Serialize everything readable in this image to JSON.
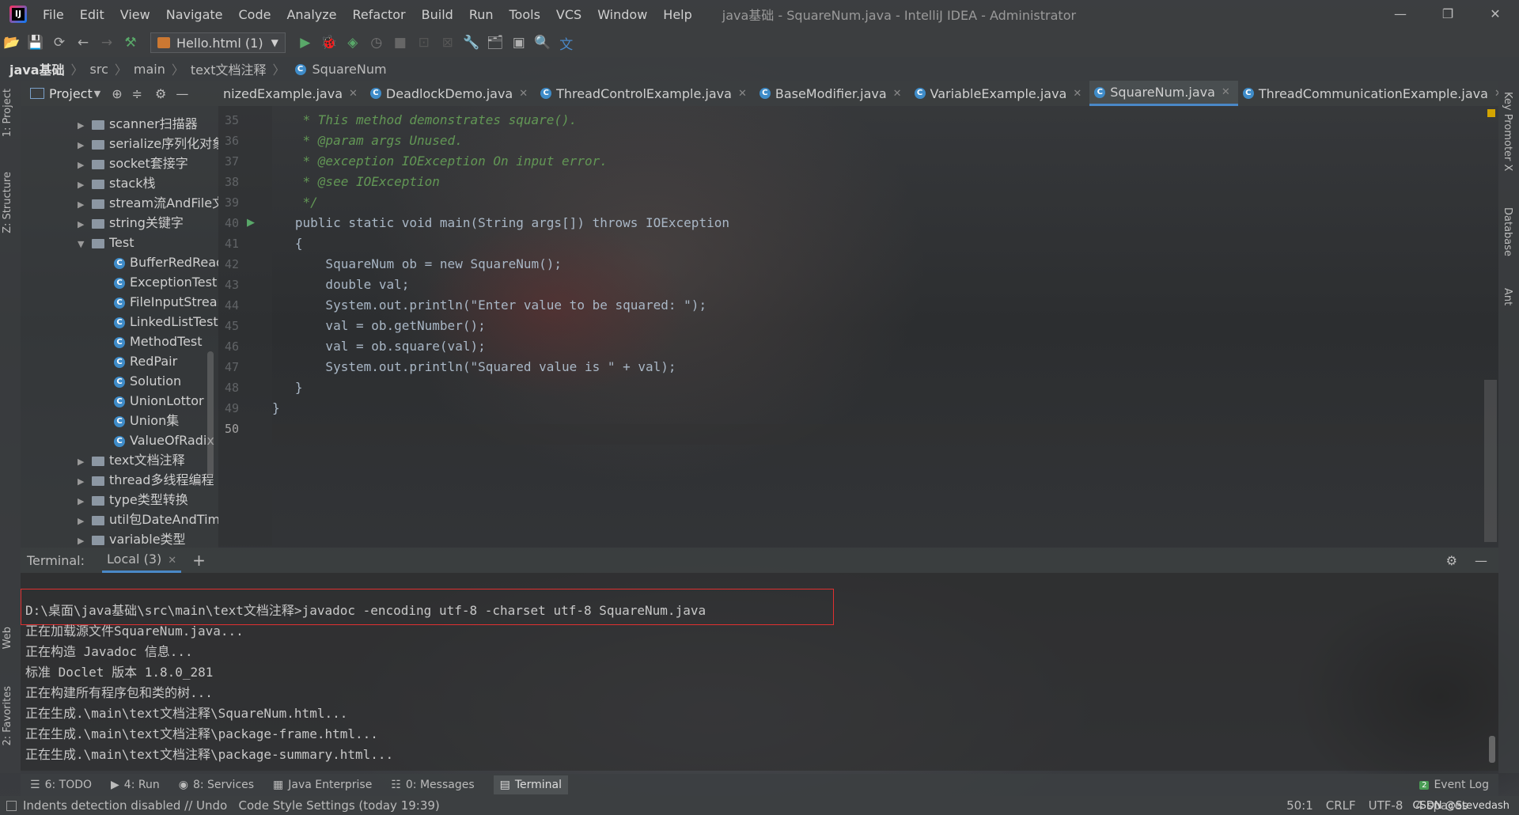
{
  "menubar": {
    "items": [
      "File",
      "Edit",
      "View",
      "Navigate",
      "Code",
      "Analyze",
      "Refactor",
      "Build",
      "Run",
      "Tools",
      "VCS",
      "Window",
      "Help"
    ],
    "title": "java基础 - SquareNum.java - IntelliJ IDEA - Administrator"
  },
  "toolbar": {
    "run_config": "Hello.html (1)"
  },
  "breadcrumb": [
    "java基础",
    "src",
    "main",
    "text文档注释",
    "SquareNum"
  ],
  "left_strip": {
    "project": "1: Project",
    "structure": "Z: Structure",
    "web": "Web",
    "favorites": "2: Favorites"
  },
  "right_strip": {
    "key_promoter": "Key Promoter X",
    "database": "Database",
    "ant": "Ant"
  },
  "project_panel": {
    "label": "Project",
    "items": [
      {
        "label": "scanner扫描器",
        "type": "folder",
        "expanded": false
      },
      {
        "label": "serialize序列化对象",
        "type": "folder",
        "expanded": false
      },
      {
        "label": "socket套接字",
        "type": "folder",
        "expanded": false
      },
      {
        "label": "stack栈",
        "type": "folder",
        "expanded": false
      },
      {
        "label": "stream流AndFile文",
        "type": "folder",
        "expanded": false
      },
      {
        "label": "string关键字",
        "type": "folder",
        "expanded": false
      },
      {
        "label": "Test",
        "type": "folder",
        "expanded": true
      },
      {
        "label": "BufferRedRead",
        "type": "class"
      },
      {
        "label": "ExceptionTest",
        "type": "class"
      },
      {
        "label": "FileInputStrean",
        "type": "class"
      },
      {
        "label": "LinkedListTest",
        "type": "class"
      },
      {
        "label": "MethodTest",
        "type": "class"
      },
      {
        "label": "RedPair",
        "type": "class"
      },
      {
        "label": "Solution",
        "type": "class"
      },
      {
        "label": "UnionLottor",
        "type": "class"
      },
      {
        "label": "Union集",
        "type": "class"
      },
      {
        "label": "ValueOfRadix",
        "type": "class"
      },
      {
        "label": "text文档注释",
        "type": "folder",
        "expanded": false
      },
      {
        "label": "thread多线程编程",
        "type": "folder",
        "expanded": false
      },
      {
        "label": "type类型转换",
        "type": "folder",
        "expanded": false
      },
      {
        "label": "util包DateAndTim",
        "type": "folder",
        "expanded": false
      },
      {
        "label": "variable类型",
        "type": "folder",
        "expanded": false
      }
    ]
  },
  "tabs": [
    {
      "label": "nizedExample.java",
      "active": false
    },
    {
      "label": "DeadlockDemo.java",
      "active": false
    },
    {
      "label": "ThreadControlExample.java",
      "active": false
    },
    {
      "label": "BaseModifier.java",
      "active": false
    },
    {
      "label": "VariableExample.java",
      "active": false
    },
    {
      "label": "SquareNum.java",
      "active": true
    },
    {
      "label": "ThreadCommunicationExample.java",
      "active": false
    },
    {
      "label": "T",
      "active": false
    }
  ],
  "editor": {
    "line_numbers": [
      "35",
      "36",
      "37",
      "38",
      "39",
      "40",
      "41",
      "42",
      "43",
      "44",
      "45",
      "46",
      "47",
      "48",
      "49",
      "50"
    ],
    "lines": [
      "    * This method demonstrates square().",
      "    * @param args Unused.",
      "    * @exception IOException On input error.",
      "    * @see IOException",
      "    */",
      "   public static void main(String args[]) throws IOException",
      "   {",
      "       SquareNum ob = new SquareNum();",
      "       double val;",
      "       System.out.println(\"Enter value to be squared: \");",
      "       val = ob.getNumber();",
      "       val = ob.square(val);",
      "       System.out.println(\"Squared value is \" + val);",
      "   }",
      "}",
      ""
    ]
  },
  "terminal": {
    "label": "Terminal:",
    "tab": "Local (3)",
    "lines": [
      "D:\\桌面\\java基础\\src\\main\\text文档注释>javadoc -encoding utf-8 -charset utf-8 SquareNum.java",
      "正在加载源文件SquareNum.java...",
      "正在构造 Javadoc 信息...",
      "标准 Doclet 版本 1.8.0_281",
      "正在构建所有程序包和类的树...",
      "正在生成.\\main\\text文档注释\\SquareNum.html...",
      "正在生成.\\main\\text文档注释\\package-frame.html...",
      "正在生成.\\main\\text文档注释\\package-summary.html..."
    ]
  },
  "bottom_tools": [
    {
      "label": "6: TODO",
      "icon": "list-icon"
    },
    {
      "label": "4: Run",
      "icon": "run-icon"
    },
    {
      "label": "8: Services",
      "icon": "services-icon"
    },
    {
      "label": "Java Enterprise",
      "icon": "enterprise-icon"
    },
    {
      "label": "0: Messages",
      "icon": "messages-icon"
    },
    {
      "label": "Terminal",
      "icon": "terminal-icon",
      "active": true
    }
  ],
  "event_log": {
    "count": "2",
    "label": "Event Log"
  },
  "statusbar": {
    "message": "Indents detection disabled // Undo   Code Style Settings (today 19:39)",
    "position": "50:1",
    "line_sep": "CRLF",
    "encoding": "UTF-8",
    "indent": "4 spaces",
    "watermark": "CSDN @Stevedash"
  },
  "colors": {
    "accent": "#4a88c7",
    "keyword": "#cc7832",
    "comment": "#629755",
    "string": "#6a8759",
    "highlight_box": "#e03030"
  }
}
